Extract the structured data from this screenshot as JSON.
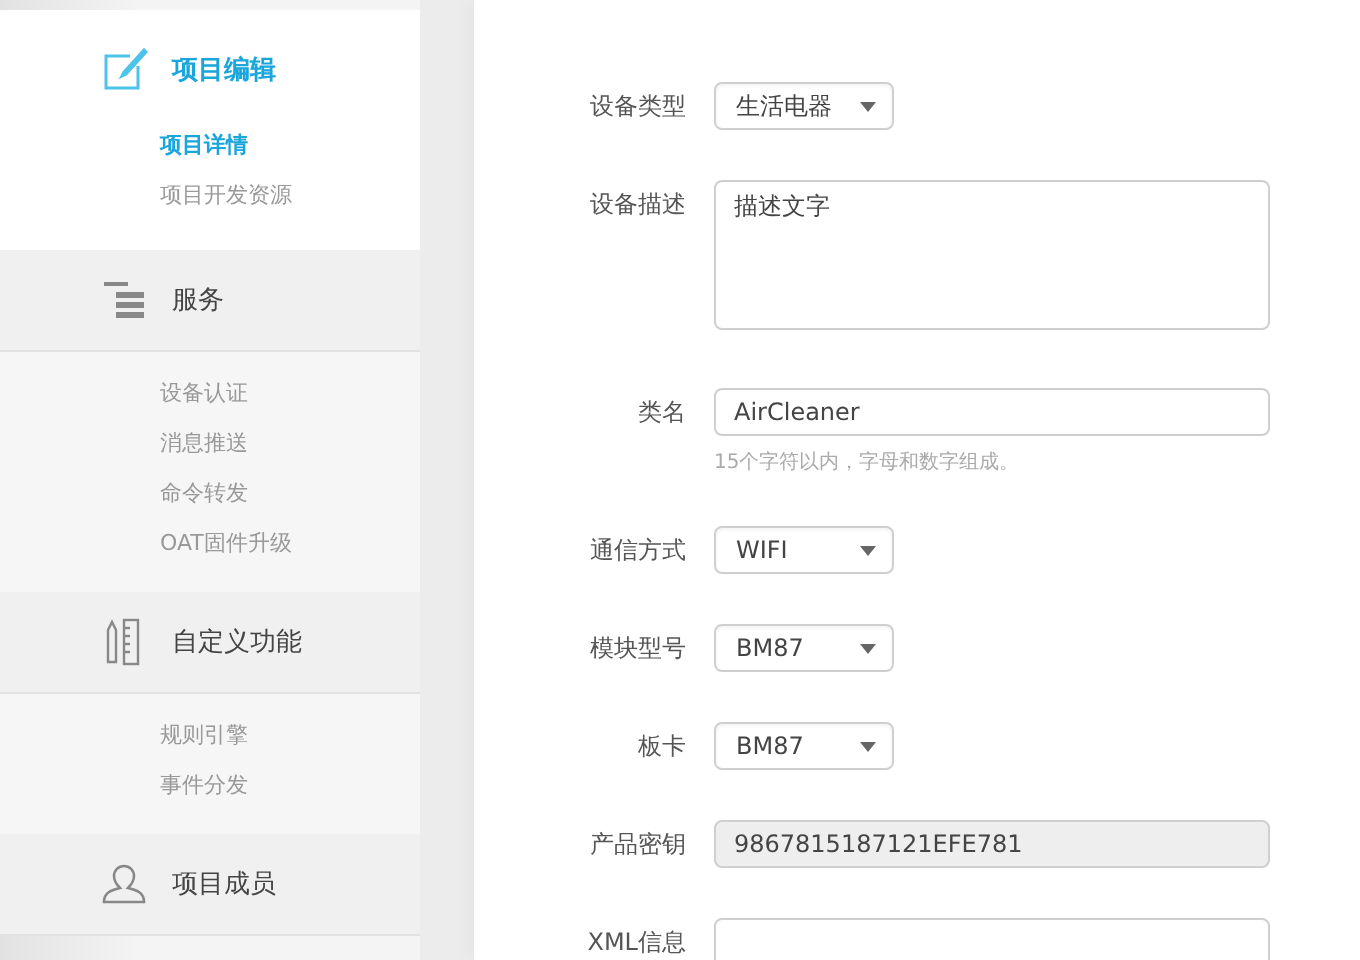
{
  "sidebar": {
    "groups": [
      {
        "title": "项目编辑",
        "active": true,
        "items": [
          {
            "label": "项目详情",
            "selected": true
          },
          {
            "label": "项目开发资源",
            "selected": false
          }
        ]
      },
      {
        "title": "服务",
        "active": false,
        "items": [
          {
            "label": "设备认证",
            "selected": false
          },
          {
            "label": "消息推送",
            "selected": false
          },
          {
            "label": "命令转发",
            "selected": false
          },
          {
            "label": "OAT固件升级",
            "selected": false
          }
        ]
      },
      {
        "title": "自定义功能",
        "active": false,
        "items": [
          {
            "label": "规则引擎",
            "selected": false
          },
          {
            "label": "事件分发",
            "selected": false
          }
        ]
      },
      {
        "title": "项目成员",
        "active": false
      }
    ]
  },
  "form": {
    "fields": [
      {
        "kind": "select",
        "label": "设备类型",
        "value": "生活电器"
      },
      {
        "kind": "textarea",
        "label": "设备描述",
        "value": "描述文字"
      },
      {
        "kind": "text",
        "label": "类名",
        "value": "AirCleaner",
        "hint": "15个字符以内，字母和数字组成。"
      },
      {
        "kind": "select",
        "label": "通信方式",
        "value": "WIFI"
      },
      {
        "kind": "select",
        "label": "模块型号",
        "value": "BM87"
      },
      {
        "kind": "select",
        "label": "板卡",
        "value": "BM87"
      },
      {
        "kind": "readonly",
        "label": "产品密钥",
        "value": "9867815187121EFE781"
      },
      {
        "kind": "textarea",
        "label": "XML信息"
      }
    ]
  }
}
